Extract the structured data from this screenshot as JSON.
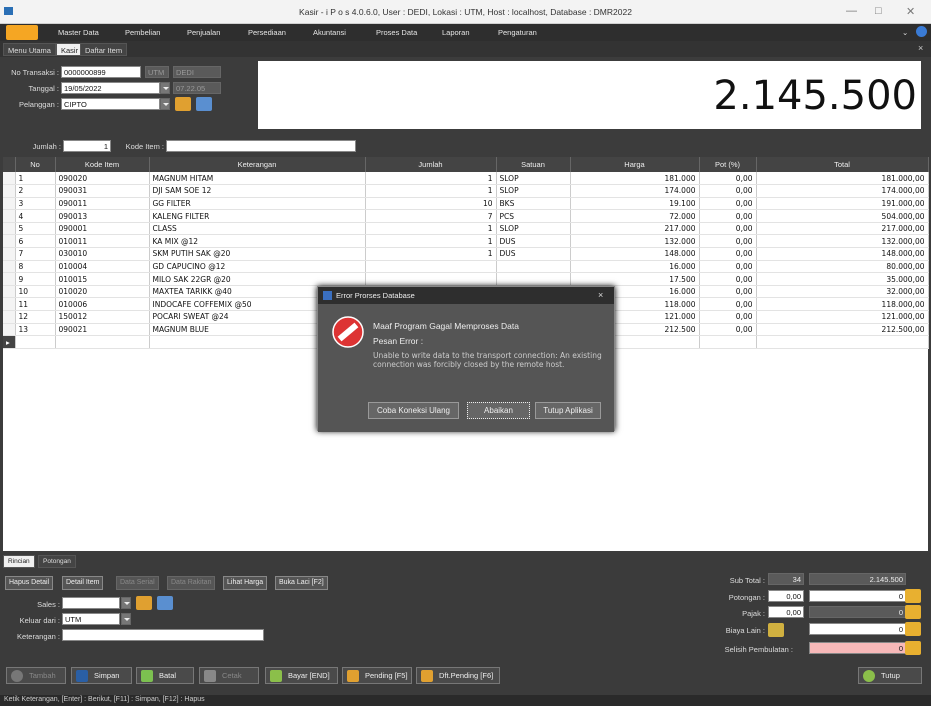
{
  "window": {
    "title": "Kasir - i P o s 4.0.6.0,  User : DEDI, Lokasi : UTM, Host : localhost, Database : DMR2022"
  },
  "menu": [
    "Master Data",
    "Pembelian",
    "Penjualan",
    "Persediaan",
    "Akuntansi",
    "Proses Data",
    "Laporan",
    "Pengaturan"
  ],
  "tabs": [
    "Menu Utama",
    "Kasir",
    "Daftar Item"
  ],
  "form": {
    "no_transaksi_label": "No Transaksi :",
    "no_transaksi": "0000000899",
    "lokasi": "UTM",
    "user": "DEDI",
    "tanggal_label": "Tanggal :",
    "tanggal": "19/05/2022",
    "jam": "07.22.05",
    "pelanggan_label": "Pelanggan :",
    "pelanggan": "CIPTO",
    "jumlah_label": "Jumlah :",
    "jumlah": "1",
    "kode_item_label": "Kode Item :",
    "kode_item": ""
  },
  "grand_total": "2.145.500",
  "table": {
    "headers": [
      "No",
      "Kode Item",
      "Keterangan",
      "Jumlah",
      "Satuan",
      "Harga",
      "Pot (%)",
      "Total"
    ],
    "rows": [
      [
        "1",
        "090020",
        "MAGNUM HITAM",
        "1",
        "SLOP",
        "181.000",
        "0,00",
        "181.000,00"
      ],
      [
        "2",
        "090031",
        "DJI SAM SOE 12",
        "1",
        "SLOP",
        "174.000",
        "0,00",
        "174.000,00"
      ],
      [
        "3",
        "090011",
        "GG FILTER",
        "10",
        "BKS",
        "19.100",
        "0,00",
        "191.000,00"
      ],
      [
        "4",
        "090013",
        "KALENG FILTER",
        "7",
        "PCS",
        "72.000",
        "0,00",
        "504.000,00"
      ],
      [
        "5",
        "090001",
        "CLASS",
        "1",
        "SLOP",
        "217.000",
        "0,00",
        "217.000,00"
      ],
      [
        "6",
        "010011",
        "KA MIX @12",
        "1",
        "DUS",
        "132.000",
        "0,00",
        "132.000,00"
      ],
      [
        "7",
        "030010",
        "SKM PUTIH SAK @20",
        "1",
        "DUS",
        "148.000",
        "0,00",
        "148.000,00"
      ],
      [
        "8",
        "010004",
        "GD CAPUCINO @12",
        "",
        "",
        "16.000",
        "0,00",
        "80.000,00"
      ],
      [
        "9",
        "010015",
        "MILO SAK 22GR @20",
        "",
        "",
        "17.500",
        "0,00",
        "35.000,00"
      ],
      [
        "10",
        "010020",
        "MAXTEA TARIKK @40",
        "",
        "",
        "16.000",
        "0,00",
        "32.000,00"
      ],
      [
        "11",
        "010006",
        "INDOCAFE COFFEMIX @50",
        "",
        "",
        "118.000",
        "0,00",
        "118.000,00"
      ],
      [
        "12",
        "150012",
        "POCARI SWEAT @24",
        "",
        "",
        "121.000",
        "0,00",
        "121.000,00"
      ],
      [
        "13",
        "090021",
        "MAGNUM BLUE",
        "",
        "",
        "212.500",
        "0,00",
        "212.500,00"
      ]
    ]
  },
  "bottom_tabs": [
    "Rincian",
    "Potongan"
  ],
  "bottom_buttons": [
    "Hapus Detail",
    "Detail Item",
    "Data Serial",
    "Data Rakitan",
    "Lihat Harga",
    "Buka Laci [F2]"
  ],
  "bottom_form": {
    "sales_label": "Sales :",
    "sales": "",
    "keluar_label": "Keluar dari :",
    "keluar": "UTM",
    "keterangan_label": "Keterangan :",
    "keterangan": ""
  },
  "summary": {
    "subtotal_label": "Sub Total :",
    "subtotal_qty": "34",
    "subtotal": "2.145.500",
    "potongan_label": "Potongan :",
    "potongan_pct": "0,00",
    "potongan": "0",
    "pajak_label": "Pajak :",
    "pajak_pct": "0,00",
    "pajak": "0",
    "biaya_label": "Biaya Lain :",
    "biaya": "0",
    "selisih_label": "Selisih Pembulatan :",
    "selisih": "0"
  },
  "actions": [
    "Tambah",
    "Simpan",
    "Batal",
    "Cetak",
    "Bayar [END]",
    "Pending [F5]",
    "Dft.Pending [F6]",
    "Tutup"
  ],
  "dialog": {
    "title": "Error Prorses Database",
    "heading": "Maaf Program Gagal Memproses Data",
    "sub": "Pesan Error :",
    "message": "Unable to write data to the transport connection: An existing connection was forcibly closed by the remote host.",
    "buttons": [
      "Coba Koneksi Ulang",
      "Abaikan",
      "Tutup Aplikasi"
    ]
  },
  "status": "Ketik Keterangan, [Enter] : Berikut, [F11] : Simpan, [F12] : Hapus"
}
